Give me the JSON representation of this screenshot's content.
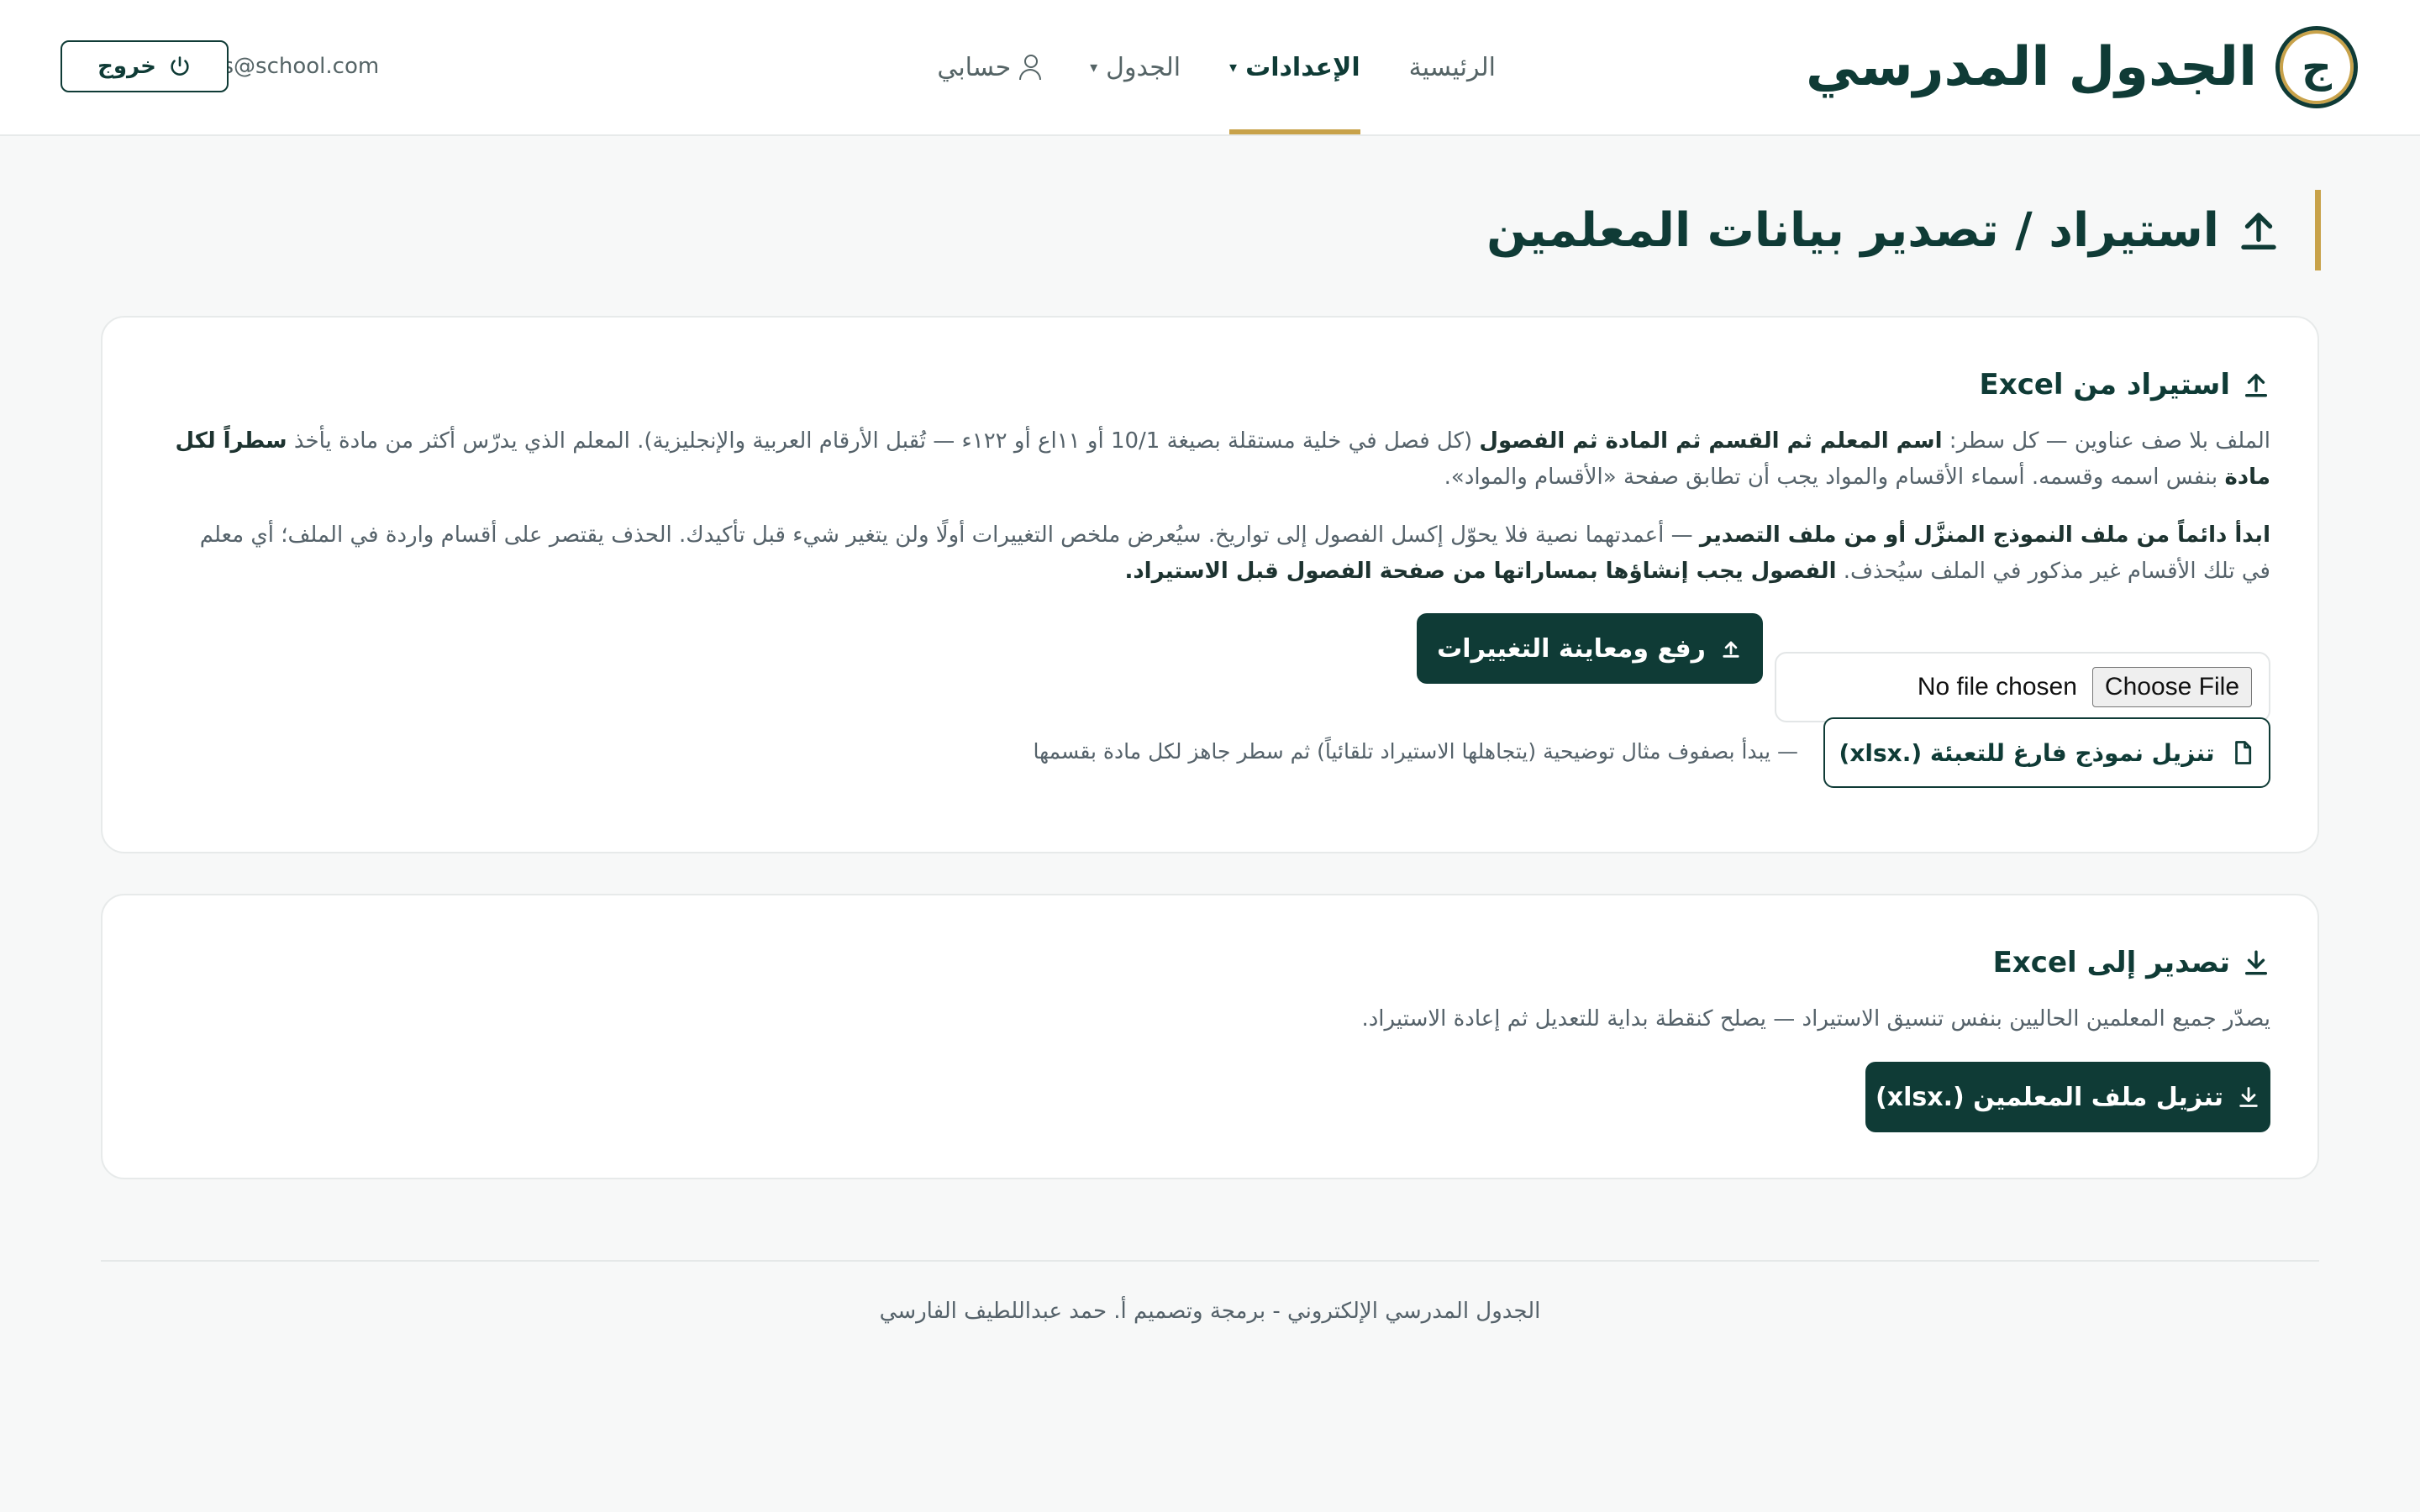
{
  "brand": {
    "logo_letter": "ج",
    "title": "الجدول المدرسي"
  },
  "nav": {
    "home": "الرئيسية",
    "settings": "الإعدادات",
    "schedule": "الجدول",
    "account": "حسابي"
  },
  "user": {
    "email": "hs@school.com",
    "logout": "خروج"
  },
  "page": {
    "title": "استيراد / تصدير بيانات المعلمين"
  },
  "import": {
    "title": "استيراد من Excel",
    "p1_a": "الملف بلا صف عناوين — كل سطر: ",
    "p1_b": "اسم المعلم ثم القسم ثم المادة ثم الفصول",
    "p1_c": " (كل فصل في خلية مستقلة بصيغة 10/1 أو ١١اع أو ١٢٢ء — تُقبل الأرقام العربية والإنجليزية). المعلم الذي يدرّس أكثر من مادة يأخذ ",
    "p1_d": "سطراً لكل مادة",
    "p1_e": " بنفس اسمه وقسمه. أسماء الأقسام والمواد يجب أن تطابق صفحة «الأقسام والمواد».",
    "p2_a": "ابدأ دائماً من ملف النموذج المنزَّل أو من ملف التصدير",
    "p2_b": " — أعمدتهما نصية فلا يحوّل إكسل الفصول إلى تواريخ. سيُعرض ملخص التغييرات أولًا ولن يتغير شيء قبل تأكيدك. الحذف يقتصر على أقسام واردة في الملف؛ أي معلم في تلك الأقسام غير مذكور في الملف سيُحذف. ",
    "p2_c": "الفصول يجب إنشاؤها بمساراتها من صفحة الفصول قبل الاستيراد.",
    "choose_file": "Choose File",
    "no_file": "No file chosen",
    "upload_button": "رفع ومعاينة التغييرات",
    "template_button": "تنزيل نموذج فارغ للتعبئة (.xlsx)",
    "template_hint": "— يبدأ بصفوف مثال توضيحية (يتجاهلها الاستيراد تلقائياً) ثم سطر جاهز لكل مادة بقسمها"
  },
  "export": {
    "title": "تصدير إلى Excel",
    "description": "يصدّر جميع المعلمين الحاليين بنفس تنسيق الاستيراد — يصلح كنقطة بداية للتعديل ثم إعادة الاستيراد.",
    "download_button": "تنزيل ملف المعلمين (.xlsx)"
  },
  "footer": {
    "text": "الجدول المدرسي الإلكتروني - برمجة وتصميم أ. حمد عبداللطيف الفارسي"
  },
  "colors": {
    "primary": "#0f3b36",
    "accent": "#c8a24a",
    "background": "#f7f8f8"
  }
}
